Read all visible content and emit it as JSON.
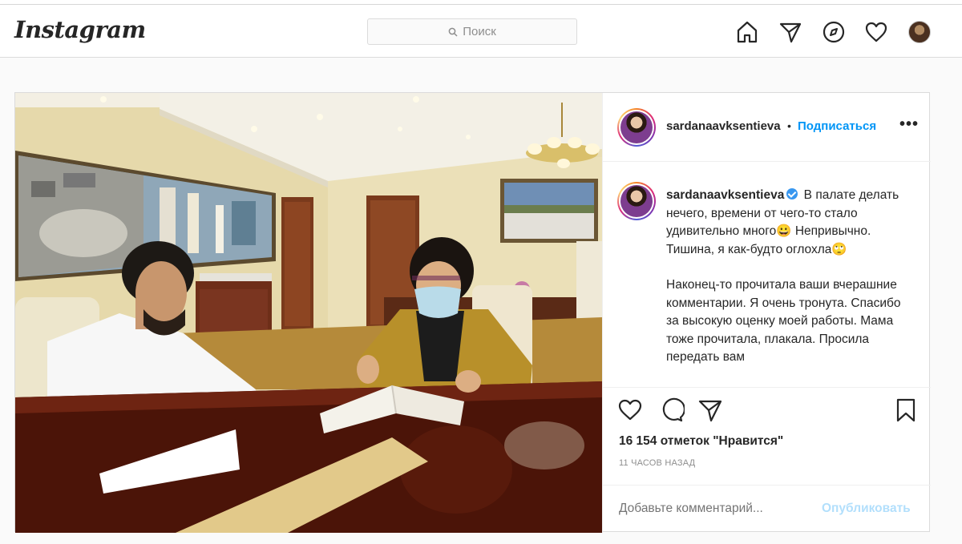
{
  "header": {
    "logo": "Instagram",
    "search_placeholder": "Поиск",
    "icons": [
      "home-icon",
      "direct-icon",
      "explore-icon",
      "activity-heart-icon",
      "profile-avatar"
    ]
  },
  "post": {
    "username": "sardanaavksentieva",
    "separator": "•",
    "follow_label": "Подписаться",
    "more_label": "•••",
    "caption": {
      "username": "sardanaavksentieva",
      "verified": true,
      "paragraph1": "В палате делать нечего, времени от чего-то стало удивительно много😀 Непривычно. Тишина, я как-будто оглохла🙄",
      "paragraph2": "Наконец-то прочитала ваши вчерашние комментарии. Я очень тронута. Спасибо за высокую оценку моей работы. Мама тоже прочитала, плакала. Просила передать вам"
    },
    "likes": "16 154 отметок \"Нравится\"",
    "time": "11 ЧАСОВ НАЗАД",
    "comment_placeholder": "Добавьте комментарий...",
    "publish_label": "Опубликовать"
  },
  "colors": {
    "accent": "#0095f6",
    "publish_disabled": "#b2dffc",
    "text": "#262626",
    "muted": "#8e8e8e",
    "border": "#dbdbdb"
  }
}
